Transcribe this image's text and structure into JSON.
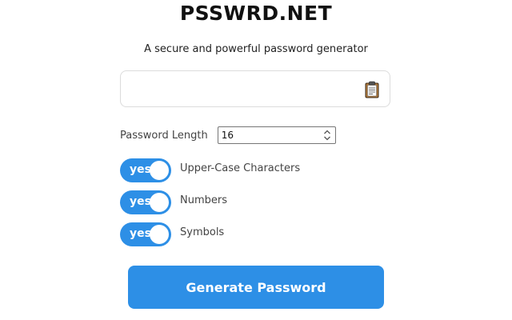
{
  "header": {
    "title": "PSSWRD.NET",
    "subtitle": "A secure and powerful password generator"
  },
  "output": {
    "value": "",
    "copy_icon": "clipboard-icon"
  },
  "length": {
    "label": "Password Length",
    "value": "16"
  },
  "options": [
    {
      "toggle": "yes",
      "label": "Upper-Case Characters",
      "enabled": true
    },
    {
      "toggle": "yes",
      "label": "Numbers",
      "enabled": true
    },
    {
      "toggle": "yes",
      "label": "Symbols",
      "enabled": true
    }
  ],
  "actions": {
    "generate_label": "Generate Password"
  },
  "colors": {
    "accent": "#2d8fe6"
  }
}
